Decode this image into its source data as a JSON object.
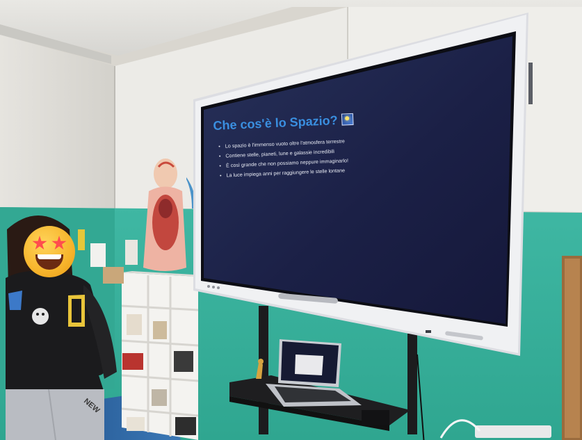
{
  "slide": {
    "title": "Che cos'è lo Spazio?",
    "title_icon": "space-image-icon",
    "bullets": [
      "Lo spazio è l'immenso vuoto oltre l'atmosfera terrestre",
      "Contiene stelle, pianeti, lune e galassie incredibili",
      "È così grande che non possiamo neppure immaginarlo!",
      "La luce impiega anni per raggiungere le stelle lontane"
    ],
    "colors": {
      "background": "#1c2244",
      "title": "#3a8fe0",
      "text": "#e6e9f2"
    }
  },
  "scene": {
    "emoji_overlay": "star-struck-emoji-icon"
  }
}
